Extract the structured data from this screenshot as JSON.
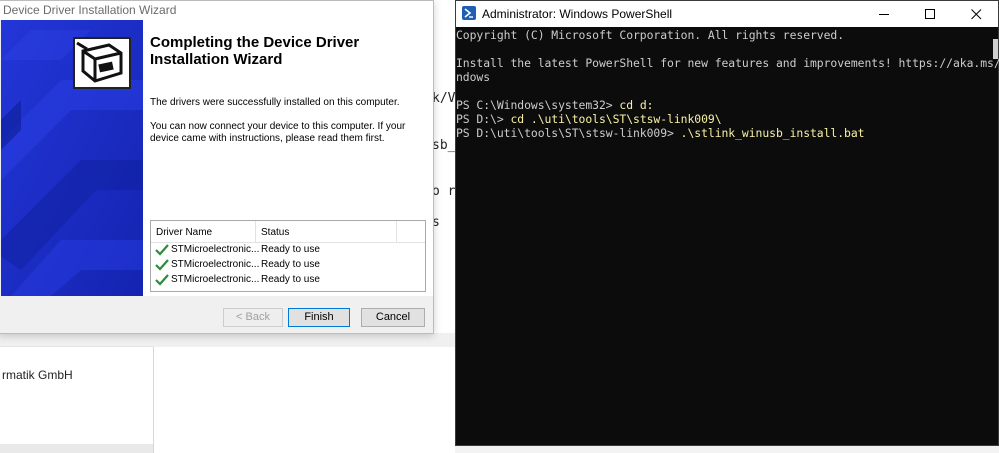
{
  "background": {
    "fragments": [
      "k/V",
      "sb_",
      "o r",
      "s"
    ],
    "company": "rmatik GmbH"
  },
  "wizard": {
    "window_title": "Device Driver Installation Wizard",
    "heading": "Completing the Device Driver Installation Wizard",
    "message1": "The drivers were successfully installed on this computer.",
    "message2": "You can now connect your device to this computer. If your device came with instructions, please read them first.",
    "table": {
      "columns": [
        "Driver Name",
        "Status"
      ],
      "rows": [
        {
          "name": "STMicroelectronic...",
          "status": "Ready to use"
        },
        {
          "name": "STMicroelectronic...",
          "status": "Ready to use"
        },
        {
          "name": "STMicroelectronic...",
          "status": "Ready to use"
        }
      ]
    },
    "buttons": {
      "back": "< Back",
      "finish": "Finish",
      "cancel": "Cancel"
    },
    "side_color": "#1b2ec7"
  },
  "powershell": {
    "window_title": "Administrator: Windows PowerShell",
    "lines": [
      {
        "text": "Copyright (C) Microsoft Corporation. All rights reserved.",
        "prompt": "",
        "cmd": ""
      },
      {
        "text": "",
        "prompt": "",
        "cmd": ""
      },
      {
        "text": "Install the latest PowerShell for new features and improvements! https://aka.ms/PSWi",
        "prompt": "",
        "cmd": ""
      },
      {
        "text": "ndows",
        "prompt": "",
        "cmd": ""
      },
      {
        "text": "",
        "prompt": "",
        "cmd": ""
      },
      {
        "text": "",
        "prompt": "PS C:\\Windows\\system32> ",
        "cmd": "cd d:"
      },
      {
        "text": "",
        "prompt": "PS D:\\> ",
        "cmd": "cd .\\uti\\tools\\ST\\stsw-link009\\"
      },
      {
        "text": "",
        "prompt": "PS D:\\uti\\tools\\ST\\stsw-link009> ",
        "cmd": ".\\stlink_winusb_install.bat"
      }
    ],
    "text_color": "#cccccc",
    "command_color": "#f9f1a5"
  }
}
